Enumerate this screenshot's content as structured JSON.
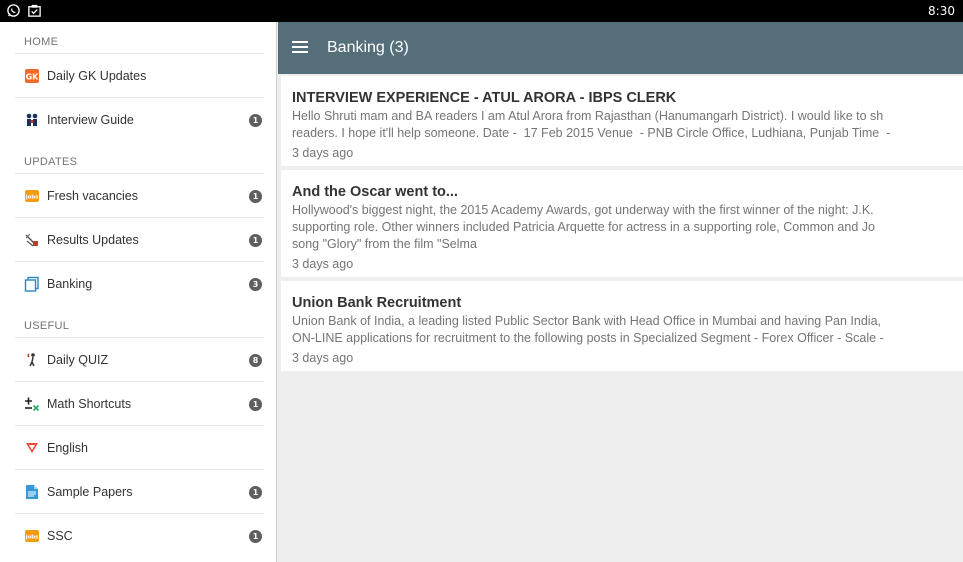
{
  "statusbar": {
    "time": "8:30",
    "icons": [
      "whatsapp-icon",
      "clipboard-icon"
    ]
  },
  "drawer": {
    "sections": [
      {
        "header": "HOME",
        "items": [
          {
            "label": "Daily GK Updates",
            "icon": "gk-icon",
            "badge": null
          },
          {
            "label": "Interview Guide",
            "icon": "interview-icon",
            "badge": "1"
          }
        ]
      },
      {
        "header": "UPDATES",
        "items": [
          {
            "label": "Fresh vacancies",
            "icon": "jobs-icon",
            "badge": "1"
          },
          {
            "label": "Results Updates",
            "icon": "results-icon",
            "badge": "1"
          },
          {
            "label": "Banking",
            "icon": "banking-icon",
            "badge": "3"
          }
        ]
      },
      {
        "header": "USEFUL",
        "items": [
          {
            "label": "Daily QUIZ",
            "icon": "quiz-icon",
            "badge": "8"
          },
          {
            "label": "Math Shortcuts",
            "icon": "math-icon",
            "badge": "1"
          },
          {
            "label": "English",
            "icon": "english-icon",
            "badge": null
          },
          {
            "label": "Sample Papers",
            "icon": "document-icon",
            "badge": "1"
          },
          {
            "label": "SSC",
            "icon": "jobs-icon",
            "badge": "1"
          }
        ]
      }
    ]
  },
  "toolbar": {
    "title": "Banking (3)"
  },
  "posts": [
    {
      "title": "INTERVIEW EXPERIENCE - ATUL ARORA - IBPS CLERK",
      "excerpt_lines": [
        "Hello Shruti mam and BA readers I am Atul Arora from Rajasthan (Hanumangarh District). I would like to sh",
        "readers. I hope it'll help someone. Date -  17 Feb 2015 Venue  - PNB Circle Office, Ludhiana, Punjab Time  -"
      ],
      "time": "3 days ago"
    },
    {
      "title": "And the Oscar went to...",
      "excerpt_lines": [
        "Hollywood's biggest night, the 2015 Academy Awards, got underway with the first winner of the night: J.K.",
        "supporting role. Other winners included Patricia Arquette for actress in a supporting role, Common and Jo",
        "song \"Glory\" from the film \"Selma"
      ],
      "time": "3 days ago"
    },
    {
      "title": "Union Bank Recruitment",
      "excerpt_lines": [
        "Union Bank of India, a leading listed Public Sector Bank with Head Office in Mumbai and having Pan India,",
        "ON-LINE applications for recruitment to the following posts in Specialized Segment - Forex Officer - Scale -"
      ],
      "time": "3 days ago"
    }
  ]
}
